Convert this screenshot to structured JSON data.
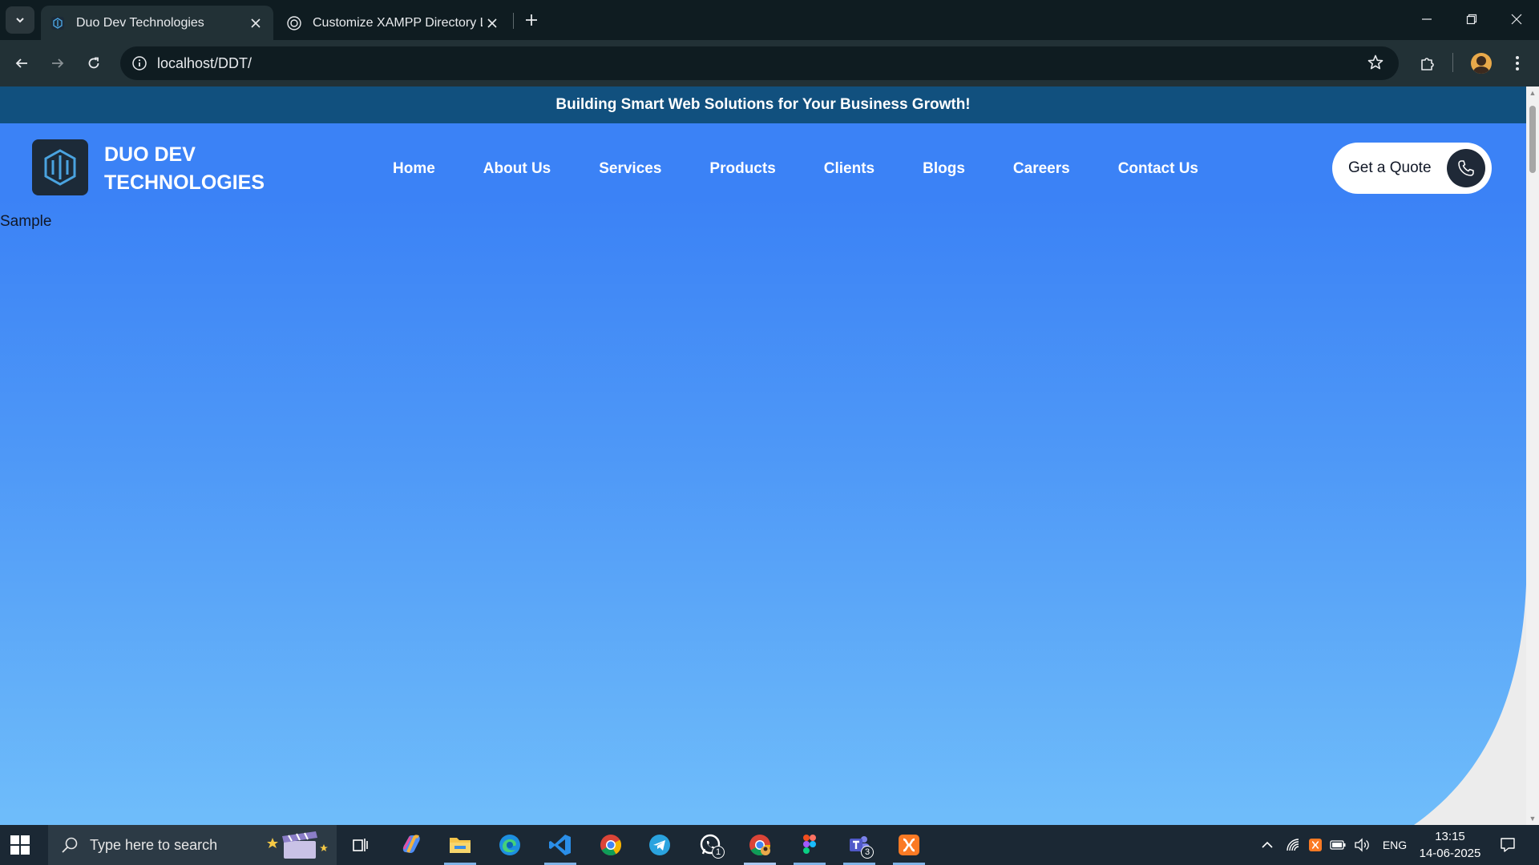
{
  "browser": {
    "tabs": [
      {
        "title": "Duo Dev Technologies",
        "active": true
      },
      {
        "title": "Customize XAMPP Directory Lis",
        "active": false
      }
    ],
    "url": "localhost/DDT/"
  },
  "page": {
    "announcement": "Building Smart Web Solutions for Your Business Growth!",
    "brand_line1": "DUO DEV",
    "brand_line2": "TECHNOLOGIES",
    "nav": [
      "Home",
      "About Us",
      "Services",
      "Products",
      "Clients",
      "Blogs",
      "Careers",
      "Contact Us"
    ],
    "cta_label": "Get a Quote",
    "body_text": "Sample",
    "colors": {
      "topbar": "#11507e",
      "header": "#3b82f6",
      "gradient_end": "#6fbdfa"
    }
  },
  "taskbar": {
    "search_placeholder": "Type here to search",
    "apps": [
      {
        "name": "task-view-icon"
      },
      {
        "name": "copilot-icon"
      },
      {
        "name": "file-explorer-icon"
      },
      {
        "name": "edge-icon"
      },
      {
        "name": "vscode-icon"
      },
      {
        "name": "chrome-icon"
      },
      {
        "name": "telegram-icon"
      },
      {
        "name": "whatsapp-icon",
        "badge": "1"
      },
      {
        "name": "chrome-profile-icon"
      },
      {
        "name": "figma-icon"
      },
      {
        "name": "teams-icon",
        "badge": "3"
      },
      {
        "name": "xampp-icon"
      }
    ],
    "language": "ENG",
    "time": "13:15",
    "date": "14-06-2025"
  }
}
